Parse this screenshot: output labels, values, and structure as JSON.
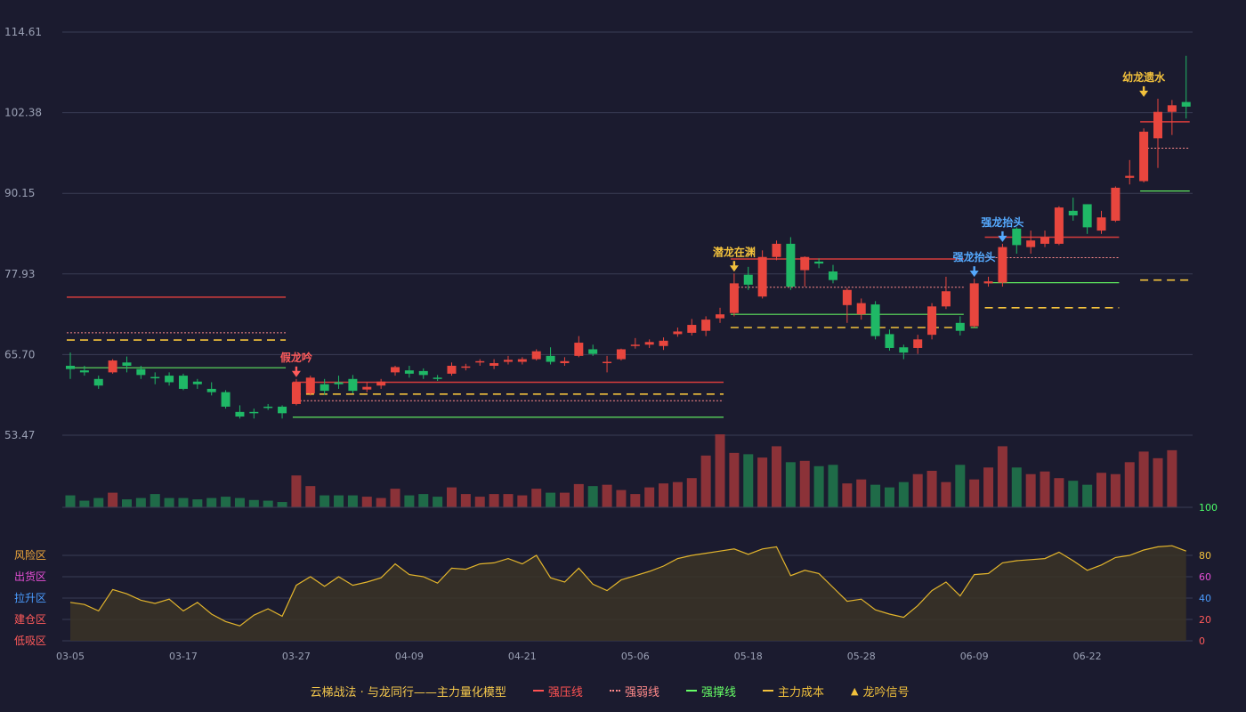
{
  "chart_data": {
    "type": "candlestick",
    "price_axis": {
      "ticks": [
        "114.61",
        "102.38",
        "90.15",
        "77.93",
        "65.70",
        "53.47"
      ],
      "ylim": [
        53.47,
        114.61
      ]
    },
    "x_tick_labels": [
      {
        "index": 0,
        "label": "03-05"
      },
      {
        "index": 8,
        "label": "03-17"
      },
      {
        "index": 16,
        "label": "03-27"
      },
      {
        "index": 24,
        "label": "04-09"
      },
      {
        "index": 32,
        "label": "04-21"
      },
      {
        "index": 40,
        "label": "05-06"
      },
      {
        "index": 48,
        "label": "05-18"
      },
      {
        "index": 56,
        "label": "05-28"
      },
      {
        "index": 64,
        "label": "06-09"
      },
      {
        "index": 72,
        "label": "06-22"
      }
    ],
    "candles": [
      [
        64.0,
        63.5,
        66.0,
        62.0
      ],
      [
        63.3,
        63.0,
        64.0,
        62.5
      ],
      [
        62.0,
        61.0,
        62.5,
        60.5
      ],
      [
        63.0,
        64.8,
        65.0,
        62.8
      ],
      [
        64.5,
        64.0,
        65.4,
        63.0
      ],
      [
        63.5,
        62.6,
        64.0,
        62.0
      ],
      [
        62.3,
        62.1,
        63.0,
        61.2
      ],
      [
        62.5,
        61.5,
        63.0,
        61.0
      ],
      [
        62.5,
        60.5,
        62.8,
        60.3
      ],
      [
        61.6,
        61.2,
        62.0,
        60.5
      ],
      [
        60.5,
        60.0,
        61.5,
        59.5
      ],
      [
        60.0,
        57.8,
        60.3,
        57.5
      ],
      [
        57.0,
        56.3,
        58.0,
        56.0
      ],
      [
        57.0,
        56.8,
        57.5,
        56.0
      ],
      [
        57.8,
        57.6,
        58.2,
        57.3
      ],
      [
        57.8,
        56.8,
        58.0,
        56.0
      ],
      [
        58.2,
        61.5,
        62.0,
        58.0
      ],
      [
        59.8,
        62.2,
        62.5,
        59.5
      ],
      [
        61.2,
        60.2,
        62.0,
        59.6
      ],
      [
        61.5,
        61.2,
        62.5,
        60.5
      ],
      [
        62.0,
        60.2,
        62.6,
        59.8
      ],
      [
        60.4,
        60.8,
        61.5,
        60.0
      ],
      [
        61.0,
        61.6,
        62.0,
        60.5
      ],
      [
        63.0,
        63.8,
        64.0,
        62.5
      ],
      [
        63.3,
        62.8,
        64.0,
        62.2
      ],
      [
        63.2,
        62.6,
        63.6,
        62.0
      ],
      [
        62.2,
        62.1,
        62.6,
        61.7
      ],
      [
        62.8,
        64.0,
        64.5,
        62.5
      ],
      [
        63.7,
        63.9,
        64.3,
        63.3
      ],
      [
        64.5,
        64.7,
        65.0,
        64.0
      ],
      [
        64.0,
        64.4,
        65.0,
        63.5
      ],
      [
        64.6,
        64.9,
        65.5,
        64.2
      ],
      [
        64.6,
        65.0,
        65.3,
        64.2
      ],
      [
        65.0,
        66.2,
        66.5,
        64.8
      ],
      [
        65.5,
        64.6,
        66.8,
        64.2
      ],
      [
        64.4,
        64.7,
        65.3,
        64.0
      ],
      [
        65.5,
        67.5,
        68.5,
        65.3
      ],
      [
        66.5,
        65.8,
        67.2,
        65.5
      ],
      [
        64.6,
        64.6,
        65.5,
        63.0
      ],
      [
        65.0,
        66.5,
        66.6,
        64.8
      ],
      [
        67.0,
        67.2,
        68.2,
        66.6
      ],
      [
        67.2,
        67.6,
        68.0,
        66.7
      ],
      [
        67.0,
        67.8,
        68.3,
        66.4
      ],
      [
        68.8,
        69.2,
        69.8,
        68.4
      ],
      [
        69.0,
        70.2,
        71.1,
        68.6
      ],
      [
        69.3,
        71.0,
        71.5,
        68.5
      ],
      [
        71.2,
        71.8,
        72.8,
        70.5
      ],
      [
        72.0,
        76.5,
        78.0,
        71.5
      ],
      [
        77.8,
        76.3,
        79.0,
        75.5
      ],
      [
        74.5,
        80.5,
        81.5,
        74.2
      ],
      [
        80.5,
        82.5,
        83.0,
        80.0
      ],
      [
        82.5,
        76.0,
        83.5,
        75.5
      ],
      [
        78.5,
        80.5,
        80.6,
        76.0
      ],
      [
        79.8,
        79.5,
        80.3,
        78.8
      ],
      [
        78.3,
        77.0,
        79.3,
        76.5
      ],
      [
        73.2,
        75.5,
        75.8,
        70.5
      ],
      [
        71.8,
        73.5,
        74.2,
        71.0
      ],
      [
        73.3,
        68.5,
        73.8,
        68.0
      ],
      [
        68.8,
        66.7,
        69.5,
        66.3
      ],
      [
        66.8,
        66.0,
        67.2,
        65.0
      ],
      [
        66.7,
        68.0,
        68.7,
        65.8
      ],
      [
        68.7,
        73.0,
        73.5,
        68.0
      ],
      [
        73.0,
        75.3,
        77.5,
        72.6
      ],
      [
        70.5,
        69.3,
        71.5,
        68.6
      ],
      [
        70.0,
        76.5,
        77.2,
        69.8
      ],
      [
        76.5,
        76.8,
        77.5,
        76.0
      ],
      [
        76.6,
        82.0,
        82.5,
        76.0
      ],
      [
        84.8,
        82.3,
        85.0,
        81.0
      ],
      [
        82.0,
        83.0,
        84.5,
        81.0
      ],
      [
        82.5,
        83.5,
        84.5,
        82.0
      ],
      [
        82.5,
        88.0,
        88.2,
        82.3
      ],
      [
        87.5,
        86.8,
        89.5,
        86.0
      ],
      [
        88.5,
        85.0,
        88.5,
        84.0
      ],
      [
        84.5,
        86.5,
        87.5,
        84.0
      ],
      [
        86.0,
        91.0,
        91.2,
        85.8
      ],
      [
        92.5,
        92.8,
        95.2,
        91.5
      ],
      [
        92.0,
        99.5,
        100.0,
        91.8
      ],
      [
        98.5,
        102.5,
        104.5,
        94.0
      ],
      [
        102.5,
        103.5,
        104.3,
        99.0
      ],
      [
        104.0,
        103.3,
        111.0,
        101.5
      ]
    ],
    "volume": [
      18,
      10,
      14,
      22,
      12,
      14,
      20,
      14,
      14,
      12,
      14,
      16,
      14,
      11,
      10,
      8,
      48,
      32,
      18,
      18,
      18,
      16,
      14,
      28,
      18,
      20,
      16,
      30,
      20,
      16,
      20,
      20,
      18,
      28,
      22,
      22,
      35,
      32,
      34,
      26,
      20,
      30,
      36,
      38,
      44,
      78,
      110,
      82,
      80,
      75,
      92,
      68,
      70,
      62,
      64,
      36,
      42,
      34,
      30,
      38,
      50,
      55,
      38,
      64,
      42,
      60,
      92,
      60,
      50,
      54,
      44,
      40,
      34,
      52,
      50,
      68,
      84,
      74,
      86
    ],
    "oscillator": {
      "ylim": [
        0,
        100
      ],
      "right_ticks": [
        "100",
        "80",
        "60",
        "40",
        "20",
        "0"
      ],
      "zones": [
        "风险区",
        "出货区",
        "拉升区",
        "建仓区",
        "低吸区"
      ],
      "values": [
        36,
        34,
        28,
        48,
        44,
        38,
        35,
        39,
        28,
        36,
        25,
        18,
        14,
        24,
        30,
        23,
        52,
        60,
        51,
        60,
        52,
        55,
        59,
        72,
        62,
        60,
        54,
        68,
        67,
        72,
        73,
        77,
        72,
        80,
        59,
        55,
        68,
        53,
        47,
        57,
        61,
        65,
        70,
        77,
        80,
        82,
        84,
        86,
        81,
        86,
        88,
        61,
        66,
        63,
        50,
        37,
        39,
        29,
        25,
        22,
        33,
        47,
        55,
        42,
        62,
        63,
        73,
        75,
        76,
        77,
        83,
        75,
        66,
        71,
        78,
        80,
        85,
        88,
        89,
        84
      ]
    },
    "resistance_lines": [
      {
        "from": 0,
        "to": 15,
        "value": 74.4
      },
      {
        "from": 16,
        "to": 46,
        "value": 61.5
      },
      {
        "from": 47,
        "to": 63,
        "value": 80.2
      },
      {
        "from": 65,
        "to": 74,
        "value": 83.5
      },
      {
        "from": 76,
        "to": 79,
        "value": 101.0
      }
    ],
    "weak_lines": [
      {
        "from": 0,
        "to": 15,
        "value": 69.0
      },
      {
        "from": 16,
        "to": 46,
        "value": 58.7
      },
      {
        "from": 47,
        "to": 63,
        "value": 75.9
      },
      {
        "from": 65,
        "to": 74,
        "value": 80.4
      },
      {
        "from": 76,
        "to": 79,
        "value": 97.0
      }
    ],
    "support_lines": [
      {
        "from": 0,
        "to": 15,
        "value": 63.7
      },
      {
        "from": 16,
        "to": 46,
        "value": 56.2
      },
      {
        "from": 47,
        "to": 63,
        "value": 71.8
      },
      {
        "from": 64,
        "to": 64,
        "value": 69.8
      },
      {
        "from": 65,
        "to": 74,
        "value": 76.6
      },
      {
        "from": 76,
        "to": 79,
        "value": 90.5
      }
    ],
    "cost_lines": [
      {
        "from": 0,
        "to": 15,
        "value": 67.9
      },
      {
        "from": 16,
        "to": 46,
        "value": 59.7
      },
      {
        "from": 47,
        "to": 63,
        "value": 69.8
      },
      {
        "from": 65,
        "to": 74,
        "value": 72.8
      },
      {
        "from": 76,
        "to": 79,
        "value": 77.0
      }
    ],
    "signals": [
      {
        "index": 16,
        "label": "假龙吟",
        "color": "#ff5b5b",
        "at": 62.0
      },
      {
        "index": 47,
        "label": "潜龙在渊",
        "color": "#f2c13c",
        "at": 78.0
      },
      {
        "index": 64,
        "label": "强龙抬头",
        "color": "#55aaff",
        "at": 77.2
      },
      {
        "index": 66,
        "label": "强龙抬头",
        "color": "#55aaff",
        "at": 82.5
      },
      {
        "index": 76,
        "label": "幼龙遗水",
        "color": "#f2c13c",
        "at": 104.5
      }
    ]
  },
  "legend": {
    "title": "云梯战法 · 与龙同行——主力量化模型",
    "items": [
      {
        "label": "强压线",
        "color": "#ff5252",
        "style": "solid"
      },
      {
        "label": "强弱线",
        "color": "#ff8a8a",
        "style": "dotted"
      },
      {
        "label": "强撑线",
        "color": "#66ff66",
        "style": "solid"
      },
      {
        "label": "主力成本",
        "color": "#f2c13c",
        "style": "dashed"
      }
    ],
    "signal_label": "龙吟信号",
    "signal_color": "#f2c13c"
  }
}
